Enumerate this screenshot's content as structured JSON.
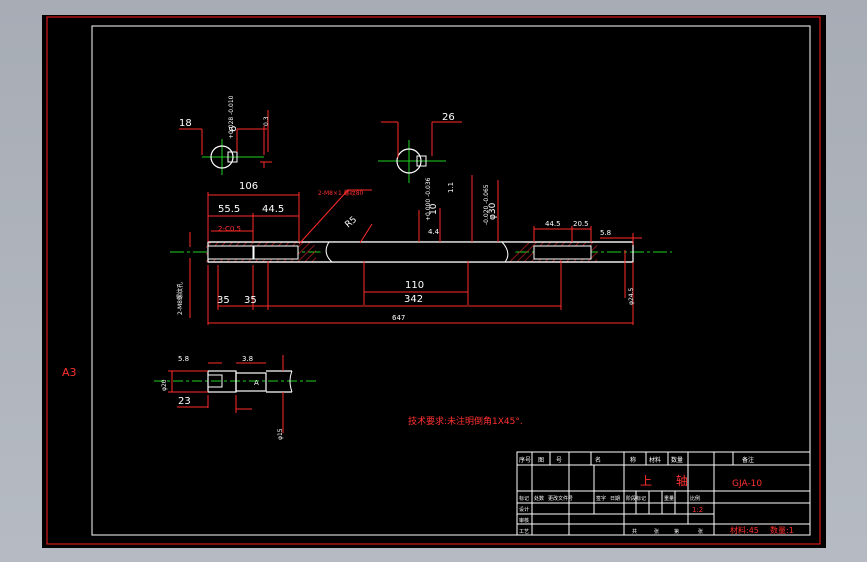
{
  "colors": {
    "background": "#000000",
    "frame_outer": "#ff2020",
    "frame_inner": "#ffffff",
    "dimension": "#ff2a2a",
    "outline": "#ffffff",
    "centerline": "#20d020",
    "hatch": "#c02020",
    "text_white": "#ffffff",
    "text_red": "#ff3030",
    "ui_bg": "#abb0b9"
  },
  "sheet": {
    "size_label": "A3"
  },
  "main_view": {
    "dims": {
      "d106": "106",
      "d55_5": "55.5",
      "d44_5": "44.5",
      "d35a": "35",
      "d35b": "35",
      "d110": "110",
      "d342": "342",
      "d647": "647",
      "d44_5r": "44.5",
      "d20_5": "20.5",
      "d5_8": "5.8",
      "d4_4": "4.4",
      "chamfer_label": "2-C0.5",
      "thread_note": "2-M8×1 螺纹80",
      "r5": "R5",
      "left_thread": "2-M8螺纹孔",
      "right_dia": "φ24.5",
      "dia_30": "φ30",
      "dia_30_tol": "-0.020 -0.065",
      "dim_10": "10",
      "dim_10_tol": "+0.000 -0.036",
      "dim_1_1": "1.1"
    }
  },
  "section_left": {
    "d18": "18",
    "d6": "6",
    "d6_tol": "+0.028 -0.010",
    "d0_3": "0.3"
  },
  "section_right": {
    "d26": "26"
  },
  "detail_view": {
    "d5_8": "5.8",
    "d3_8": "3.8",
    "d23": "23",
    "dia_left": "φ20",
    "dia_right": "φ15",
    "ref_label": "A"
  },
  "tech_req": "技术要求:未注明倒角1X45°.",
  "title_block": {
    "header_cells": [
      "序号",
      "图",
      "号",
      "名",
      "称",
      "材料",
      "数量",
      "备注"
    ],
    "part_name": "上 轴",
    "drawing_no": "GJA-10",
    "material": "材料:45",
    "quantity": "数量:1",
    "scale": "1:2",
    "row_labels": [
      "标记",
      "处数",
      "更改文件号",
      "签字",
      "日期"
    ],
    "roles": [
      "设计",
      "审核",
      "工艺"
    ],
    "stage_labels": [
      "阶段标记",
      "重量",
      "比例"
    ],
    "sheet_labels": [
      "共",
      "张",
      "第",
      "张"
    ]
  }
}
